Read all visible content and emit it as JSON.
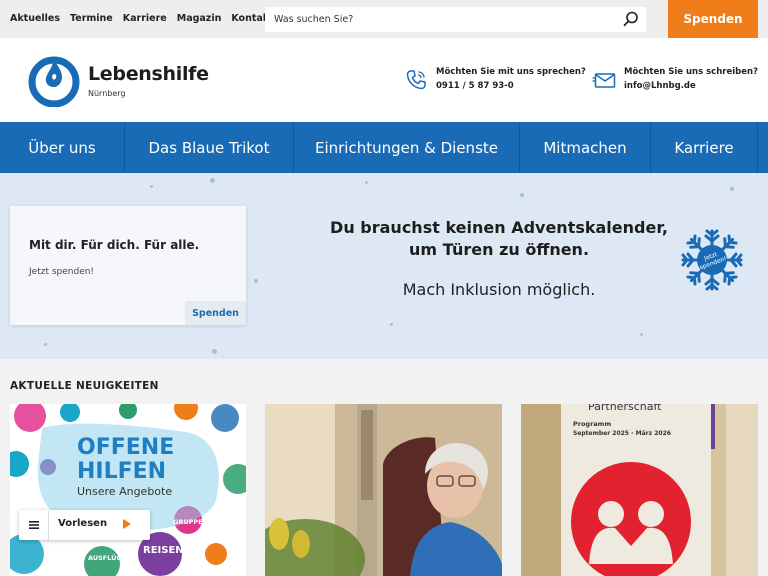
{
  "topbar": {
    "links": [
      "Aktuelles",
      "Termine",
      "Karriere",
      "Magazin",
      "Kontakt"
    ],
    "search_placeholder": "Was suchen Sie?",
    "donate_label": "Spenden"
  },
  "header": {
    "logo_name": "Lebenshilfe",
    "logo_city": "Nürnberg",
    "phone_label": "Möchten Sie mit uns sprechen?",
    "phone_value": "0911 / 5 87 93-0",
    "mail_label": "Möchten Sie uns schreiben?",
    "mail_value": "info@Lhnbg.de"
  },
  "nav": {
    "items": [
      "Über uns",
      "Das Blaue Trikot",
      "Einrichtungen & Dienste",
      "Mitmachen",
      "Karriere"
    ]
  },
  "hero": {
    "card_title": "Mit dir. Für dich. Für alle.",
    "card_text": "Jetzt spenden!",
    "card_button": "Spenden",
    "headline_line1": "Du brauchst keinen Adventskalender,",
    "headline_line2": "um Türen zu öffnen.",
    "subline": "Mach Inklusion möglich.",
    "badge_text_line1": "Jetzt",
    "badge_text_line2": "spenden!"
  },
  "news": {
    "section_title": "AKTUELLE NEUIGKEITEN",
    "tile1": {
      "line1": "OFFENE",
      "line2": "HILFEN",
      "line3": "Unsere Angebote",
      "tag_groups": "GRUPPEN",
      "tag_travel": "REISEN",
      "tag_trips": "AUSFLÜGE"
    },
    "tile3": {
      "heading": "Partnerschaft",
      "program_label": "Programm",
      "program_period": "September 2025 - März 2026"
    }
  },
  "reader": {
    "label": "Vorlesen"
  },
  "colors": {
    "brand_blue": "#1a6bb5",
    "accent_orange": "#ef7d1a",
    "hero_bg": "#dde8f4"
  }
}
